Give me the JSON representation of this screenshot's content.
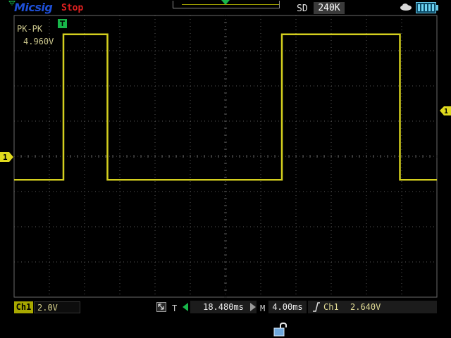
{
  "header": {
    "brand": "Micsig",
    "run_status": "Stop",
    "acquisition_mode": "SD",
    "memory_depth": "240K"
  },
  "measurement": {
    "label": "PK-PK",
    "value": "4.960V"
  },
  "channel1": {
    "badge": "Ch1",
    "marker": "1",
    "volts_per_div": "2.0V"
  },
  "timebase": {
    "trigger_position_label": "T",
    "trigger_position": "18.480ms",
    "timebase_label": "M",
    "time_per_div": "4.00ms"
  },
  "trigger": {
    "source": "Ch1",
    "level": "2.640V",
    "marker": "1"
  },
  "chart_data": {
    "type": "line",
    "series": [
      {
        "values": [
          [
            0,
            0
          ],
          [
            2.8,
            0
          ],
          [
            2.8,
            4.96
          ],
          [
            5.3,
            4.96
          ],
          [
            5.3,
            0
          ],
          [
            15.2,
            0
          ],
          [
            15.2,
            4.96
          ],
          [
            21.9,
            4.96
          ],
          [
            21.9,
            0
          ],
          [
            24,
            0
          ]
        ]
      }
    ],
    "xlim": [
      0,
      24
    ],
    "ylim": [
      -4,
      5.6
    ],
    "grid": true,
    "colors": {
      "trace": "#d4cf1e",
      "grid": "#5a5a5a",
      "background": "#000000"
    }
  },
  "icons": [
    "trigger-marker-icon",
    "cloud-icon",
    "battery-icon",
    "zoom-icon",
    "edge-rising-icon",
    "lock-icon"
  ]
}
